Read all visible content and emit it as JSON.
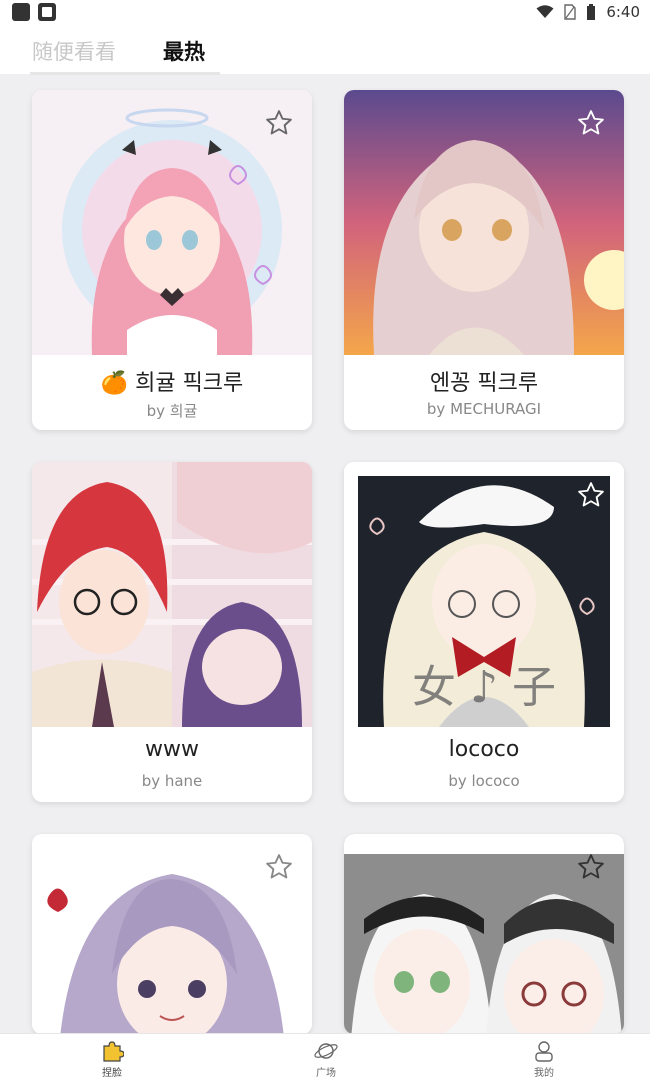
{
  "status_bar": {
    "time": "6:40"
  },
  "tabs": [
    {
      "label": "随便看看",
      "active": false
    },
    {
      "label": "最热",
      "active": true
    }
  ],
  "cards": [
    {
      "title": "희귤 픽크루",
      "emoji": "🍊",
      "author": "by 희귤"
    },
    {
      "title": "엔꽁 픽크루",
      "author": "by MECHURAGI"
    },
    {
      "title": "www",
      "author": "by hane"
    },
    {
      "title": "lococo",
      "author": "by lococo"
    },
    {
      "title": "",
      "author": ""
    },
    {
      "title": "",
      "author": ""
    }
  ],
  "bottom_nav": [
    {
      "label": "捏脸",
      "icon": "puzzle-icon",
      "active": true
    },
    {
      "label": "广场",
      "icon": "planet-icon",
      "active": false
    },
    {
      "label": "我的",
      "icon": "user-icon",
      "active": false
    }
  ],
  "colors": {
    "active_tab": "#111111",
    "inactive_tab": "#c8c8c8",
    "accent": "#e8b400"
  }
}
